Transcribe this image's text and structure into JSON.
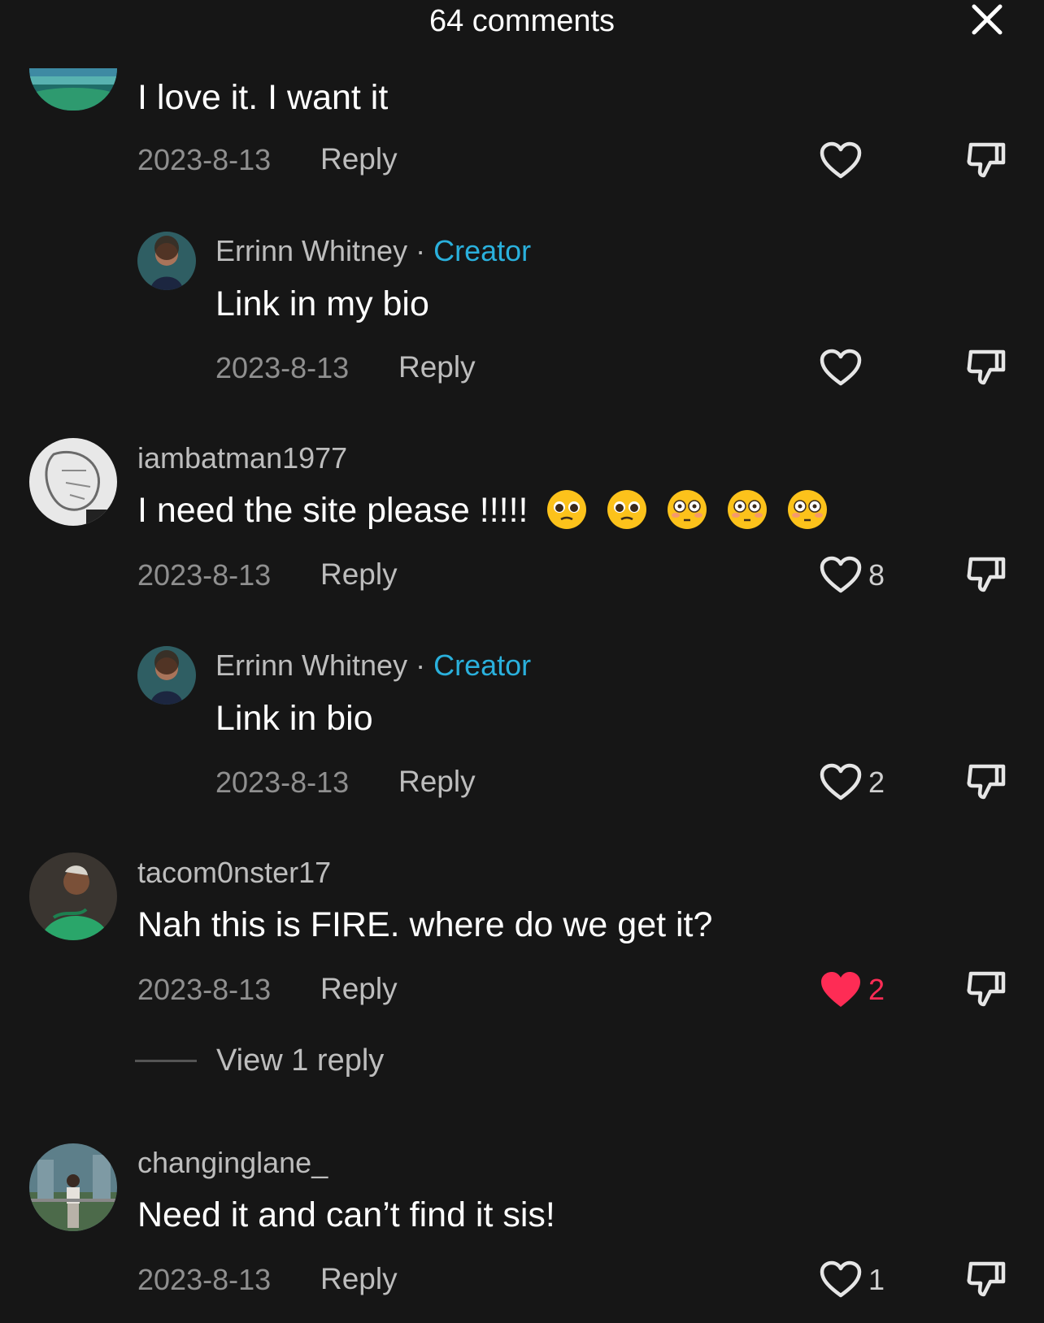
{
  "header": {
    "title": "64 comments",
    "close_icon": "close-icon"
  },
  "comments": [
    {
      "user": "",
      "text": "I love it. I want it",
      "date": "2023-8-13",
      "reply": "Reply",
      "likes": "",
      "liked": false
    },
    {
      "user": "Errinn Whitney",
      "badge": "Creator",
      "text": "Link in my bio",
      "date": "2023-8-13",
      "reply": "Reply",
      "likes": "",
      "liked": false
    },
    {
      "user": "iambatman1977",
      "text": "I need the site please !!!!!",
      "emojis": [
        "pleading-face-emoji",
        "pleading-face-emoji",
        "flushed-face-emoji",
        "flushed-face-emoji",
        "flushed-face-emoji"
      ],
      "date": "2023-8-13",
      "reply": "Reply",
      "likes": "8",
      "liked": false
    },
    {
      "user": "Errinn Whitney",
      "badge": "Creator",
      "text": "Link in bio",
      "date": "2023-8-13",
      "reply": "Reply",
      "likes": "2",
      "liked": false
    },
    {
      "user": "tacom0nster17",
      "text": "Nah this is FIRE. where do we get it?",
      "date": "2023-8-13",
      "reply": "Reply",
      "likes": "2",
      "liked": true,
      "view_replies": "View 1 reply"
    },
    {
      "user": "changinglane_",
      "text": "Need it and can’t find it sis!",
      "date": "2023-8-13",
      "reply": "Reply",
      "likes": "1",
      "liked": false
    }
  ],
  "separator": "·",
  "colors": {
    "background": "#161616",
    "creator": "#2ab0dc",
    "liked": "#fe2c55"
  }
}
